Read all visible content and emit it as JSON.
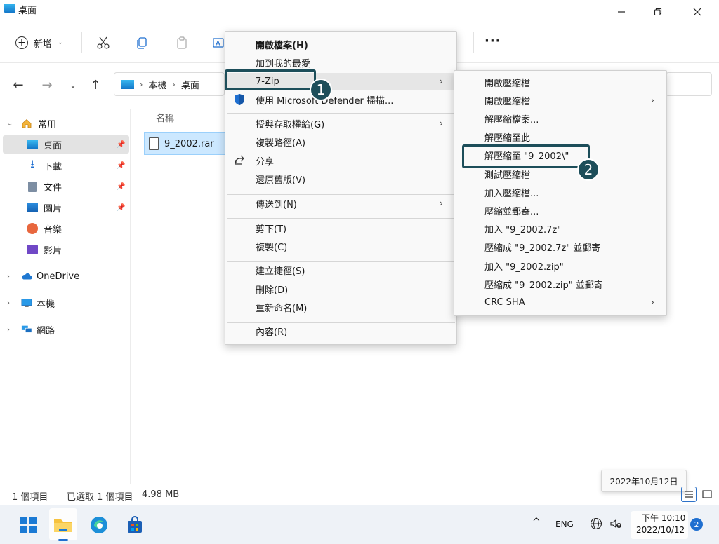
{
  "window": {
    "title": "桌面",
    "controls": [
      "minimize",
      "maximize",
      "close"
    ]
  },
  "toolbar": {
    "new_label": "新增",
    "icons": [
      "cut-icon",
      "copy-icon",
      "paste-icon",
      "rename-icon"
    ],
    "more_label": "···"
  },
  "address": {
    "crumbs": [
      "本機",
      "桌面"
    ]
  },
  "navpane": {
    "quick_access_label": "常用",
    "pinned": [
      {
        "label": "桌面",
        "icon": "desktop-icon",
        "pinned": true,
        "selected": true
      },
      {
        "label": "下載",
        "icon": "download-icon",
        "pinned": true
      },
      {
        "label": "文件",
        "icon": "document-icon",
        "pinned": true
      },
      {
        "label": "圖片",
        "icon": "pictures-icon",
        "pinned": true
      },
      {
        "label": "音樂",
        "icon": "music-icon",
        "pinned": false
      },
      {
        "label": "影片",
        "icon": "video-icon",
        "pinned": false
      }
    ],
    "roots": [
      {
        "label": "OneDrive",
        "icon": "cloud-icon"
      },
      {
        "label": "本機",
        "icon": "pc-icon"
      },
      {
        "label": "網路",
        "icon": "network-icon"
      }
    ]
  },
  "filelist": {
    "column_name": "名稱",
    "files": [
      {
        "name": "9_2002.rar",
        "selected": true
      }
    ]
  },
  "context_menu": {
    "items": [
      {
        "label": "開啟檔案(H)",
        "bold": true
      },
      {
        "label": "加到我的最愛"
      },
      {
        "label": "7-Zip",
        "submenu": true,
        "highlighted": true
      },
      {
        "label": "使用 Microsoft Defender 掃描...",
        "icon": "defender-shield-icon"
      },
      {
        "sep": true
      },
      {
        "label": "授與存取權給(G)",
        "submenu": true
      },
      {
        "label": "複製路徑(A)"
      },
      {
        "label": "分享",
        "icon": "share-icon"
      },
      {
        "label": "還原舊版(V)"
      },
      {
        "sep": true
      },
      {
        "label": "傳送到(N)",
        "submenu": true
      },
      {
        "sep": true
      },
      {
        "label": "剪下(T)"
      },
      {
        "label": "複製(C)"
      },
      {
        "sep": true
      },
      {
        "label": "建立捷徑(S)"
      },
      {
        "label": "刪除(D)"
      },
      {
        "label": "重新命名(M)"
      },
      {
        "sep": true
      },
      {
        "label": "內容(R)"
      }
    ]
  },
  "submenu_7zip": {
    "items": [
      {
        "label": "開啟壓縮檔"
      },
      {
        "label": "開啟壓縮檔",
        "submenu": true
      },
      {
        "label": "解壓縮檔案..."
      },
      {
        "label": "解壓縮至此"
      },
      {
        "label": "解壓縮至 \"9_2002\\\"",
        "highlighted": true
      },
      {
        "label": "測試壓縮檔"
      },
      {
        "label": "加入壓縮檔..."
      },
      {
        "label": "壓縮並郵寄..."
      },
      {
        "label": "加入 \"9_2002.7z\""
      },
      {
        "label": "壓縮成 \"9_2002.7z\" 並郵寄"
      },
      {
        "label": "加入 \"9_2002.zip\""
      },
      {
        "label": "壓縮成 \"9_2002.zip\" 並郵寄"
      },
      {
        "label": "CRC SHA",
        "submenu": true
      }
    ]
  },
  "callouts": {
    "one": "1",
    "two": "2"
  },
  "tooltip": {
    "text": "2022年10月12日"
  },
  "status": {
    "count": "1 個項目",
    "selected": "已選取 1 個項目",
    "size": "4.98 MB"
  },
  "taskbar": {
    "apps": [
      "windows-start-icon",
      "file-explorer-icon",
      "edge-icon",
      "store-icon"
    ],
    "tray_chevron": "^",
    "lang": "ENG",
    "time": "下午 10:10",
    "date": "2022/10/12",
    "notifications": "2"
  },
  "colors": {
    "accent": "#1d4e5a",
    "selection": "#cce8ff",
    "taskbar": "#eef2f7",
    "windows_blue": "#1f6fd0"
  }
}
